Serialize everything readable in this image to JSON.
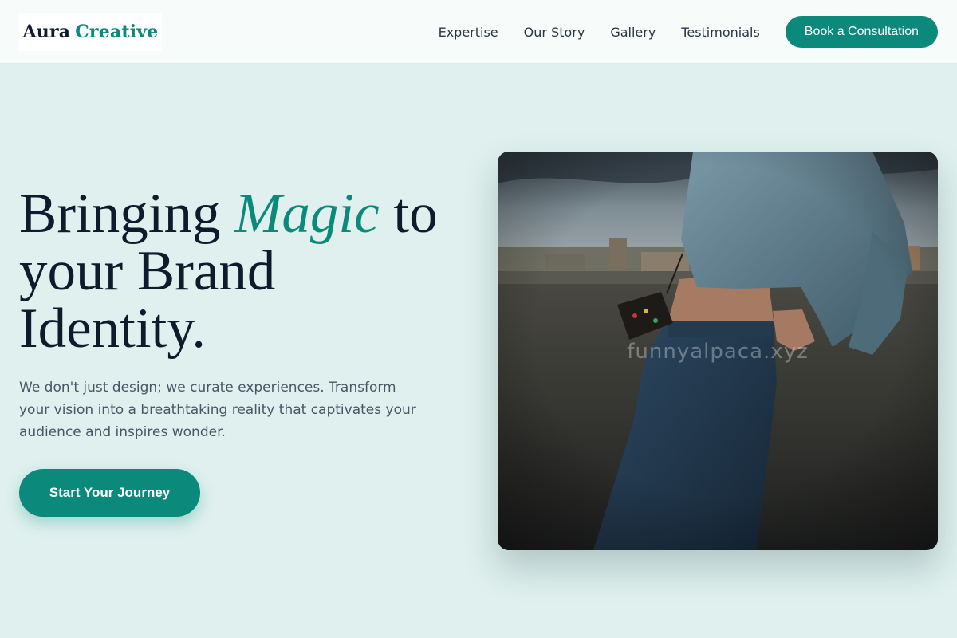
{
  "brand": {
    "word1": "Aura",
    "word2": "Creative"
  },
  "nav": {
    "items": [
      {
        "label": "Expertise"
      },
      {
        "label": "Our Story"
      },
      {
        "label": "Gallery"
      },
      {
        "label": "Testimonials"
      }
    ],
    "cta_label": "Book a Consultation"
  },
  "hero": {
    "title_before": "Bringing ",
    "title_accent": "Magic",
    "title_after": " to your Brand Identity.",
    "subtitle": "We don't just design; we curate experiences. Transform your vision into a breathtaking reality that captivates your audience and inspires wonder.",
    "cta_label": "Start Your Journey",
    "image_watermark": "funnyalpaca.xyz"
  },
  "colors": {
    "accent": "#0b8a7b",
    "page_bg": "#dff0ee",
    "header_bg": "#f7fbfa",
    "heading": "#0f1b2d",
    "body_text": "#4a5668"
  }
}
